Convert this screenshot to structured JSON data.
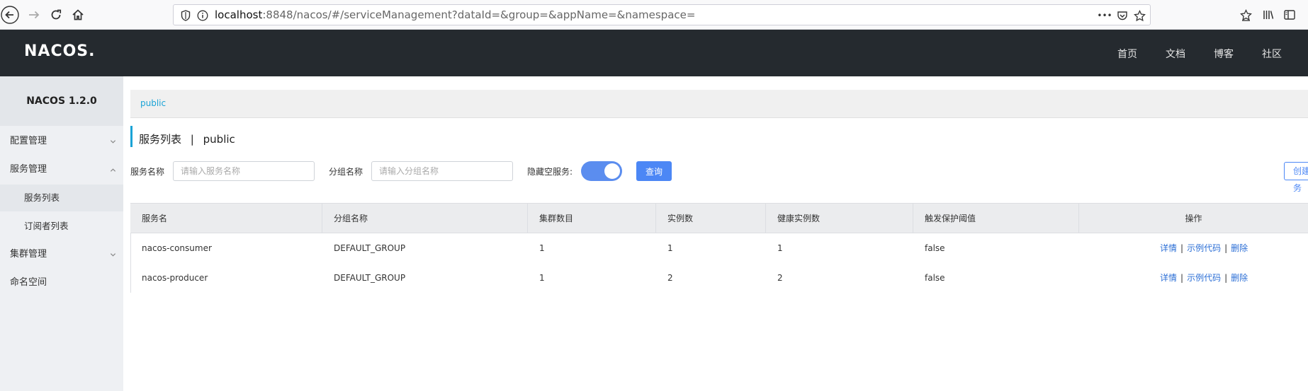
{
  "browser": {
    "url_host": "localhost",
    "url_rest": ":8848/nacos/#/serviceManagement?dataId=&group=&appName=&namespace=",
    "more_label": "•••"
  },
  "header": {
    "logo": "NACOS.",
    "nav": [
      "首页",
      "文档",
      "博客",
      "社区"
    ]
  },
  "sidebar": {
    "title": "NACOS 1.2.0",
    "items": [
      {
        "label": "配置管理",
        "expanded": false
      },
      {
        "label": "服务管理",
        "expanded": true
      },
      {
        "label": "服务列表",
        "sub": true,
        "active": true
      },
      {
        "label": "订阅者列表",
        "sub": true
      },
      {
        "label": "集群管理",
        "expanded": false
      },
      {
        "label": "命名空间"
      }
    ]
  },
  "main": {
    "breadcrumb": "public",
    "title": "服务列表",
    "title_separator": "|",
    "namespace": "public",
    "filters": {
      "service_label": "服务名称",
      "service_placeholder": "请输入服务名称",
      "group_label": "分组名称",
      "group_placeholder": "请输入分组名称",
      "hide_empty_label": "隐藏空服务:",
      "hide_empty_on": true,
      "query_button": "查询",
      "create_button": "创建服务"
    },
    "table": {
      "columns": [
        "服务名",
        "分组名称",
        "集群数目",
        "实例数",
        "健康实例数",
        "触发保护阈值",
        "操作"
      ],
      "rows": [
        {
          "name": "nacos-consumer",
          "group": "DEFAULT_GROUP",
          "clusters": "1",
          "instances": "1",
          "healthy": "1",
          "threshold": "false"
        },
        {
          "name": "nacos-producer",
          "group": "DEFAULT_GROUP",
          "clusters": "1",
          "instances": "2",
          "healthy": "2",
          "threshold": "false"
        }
      ],
      "actions": {
        "detail": "详情",
        "sample": "示例代码",
        "delete": "删除",
        "separator": "|"
      }
    }
  },
  "colors": {
    "header_bg": "#252a2f",
    "accent": "#1aa3d6",
    "primary_button": "#4c87f5",
    "link": "#2c6fd6"
  }
}
